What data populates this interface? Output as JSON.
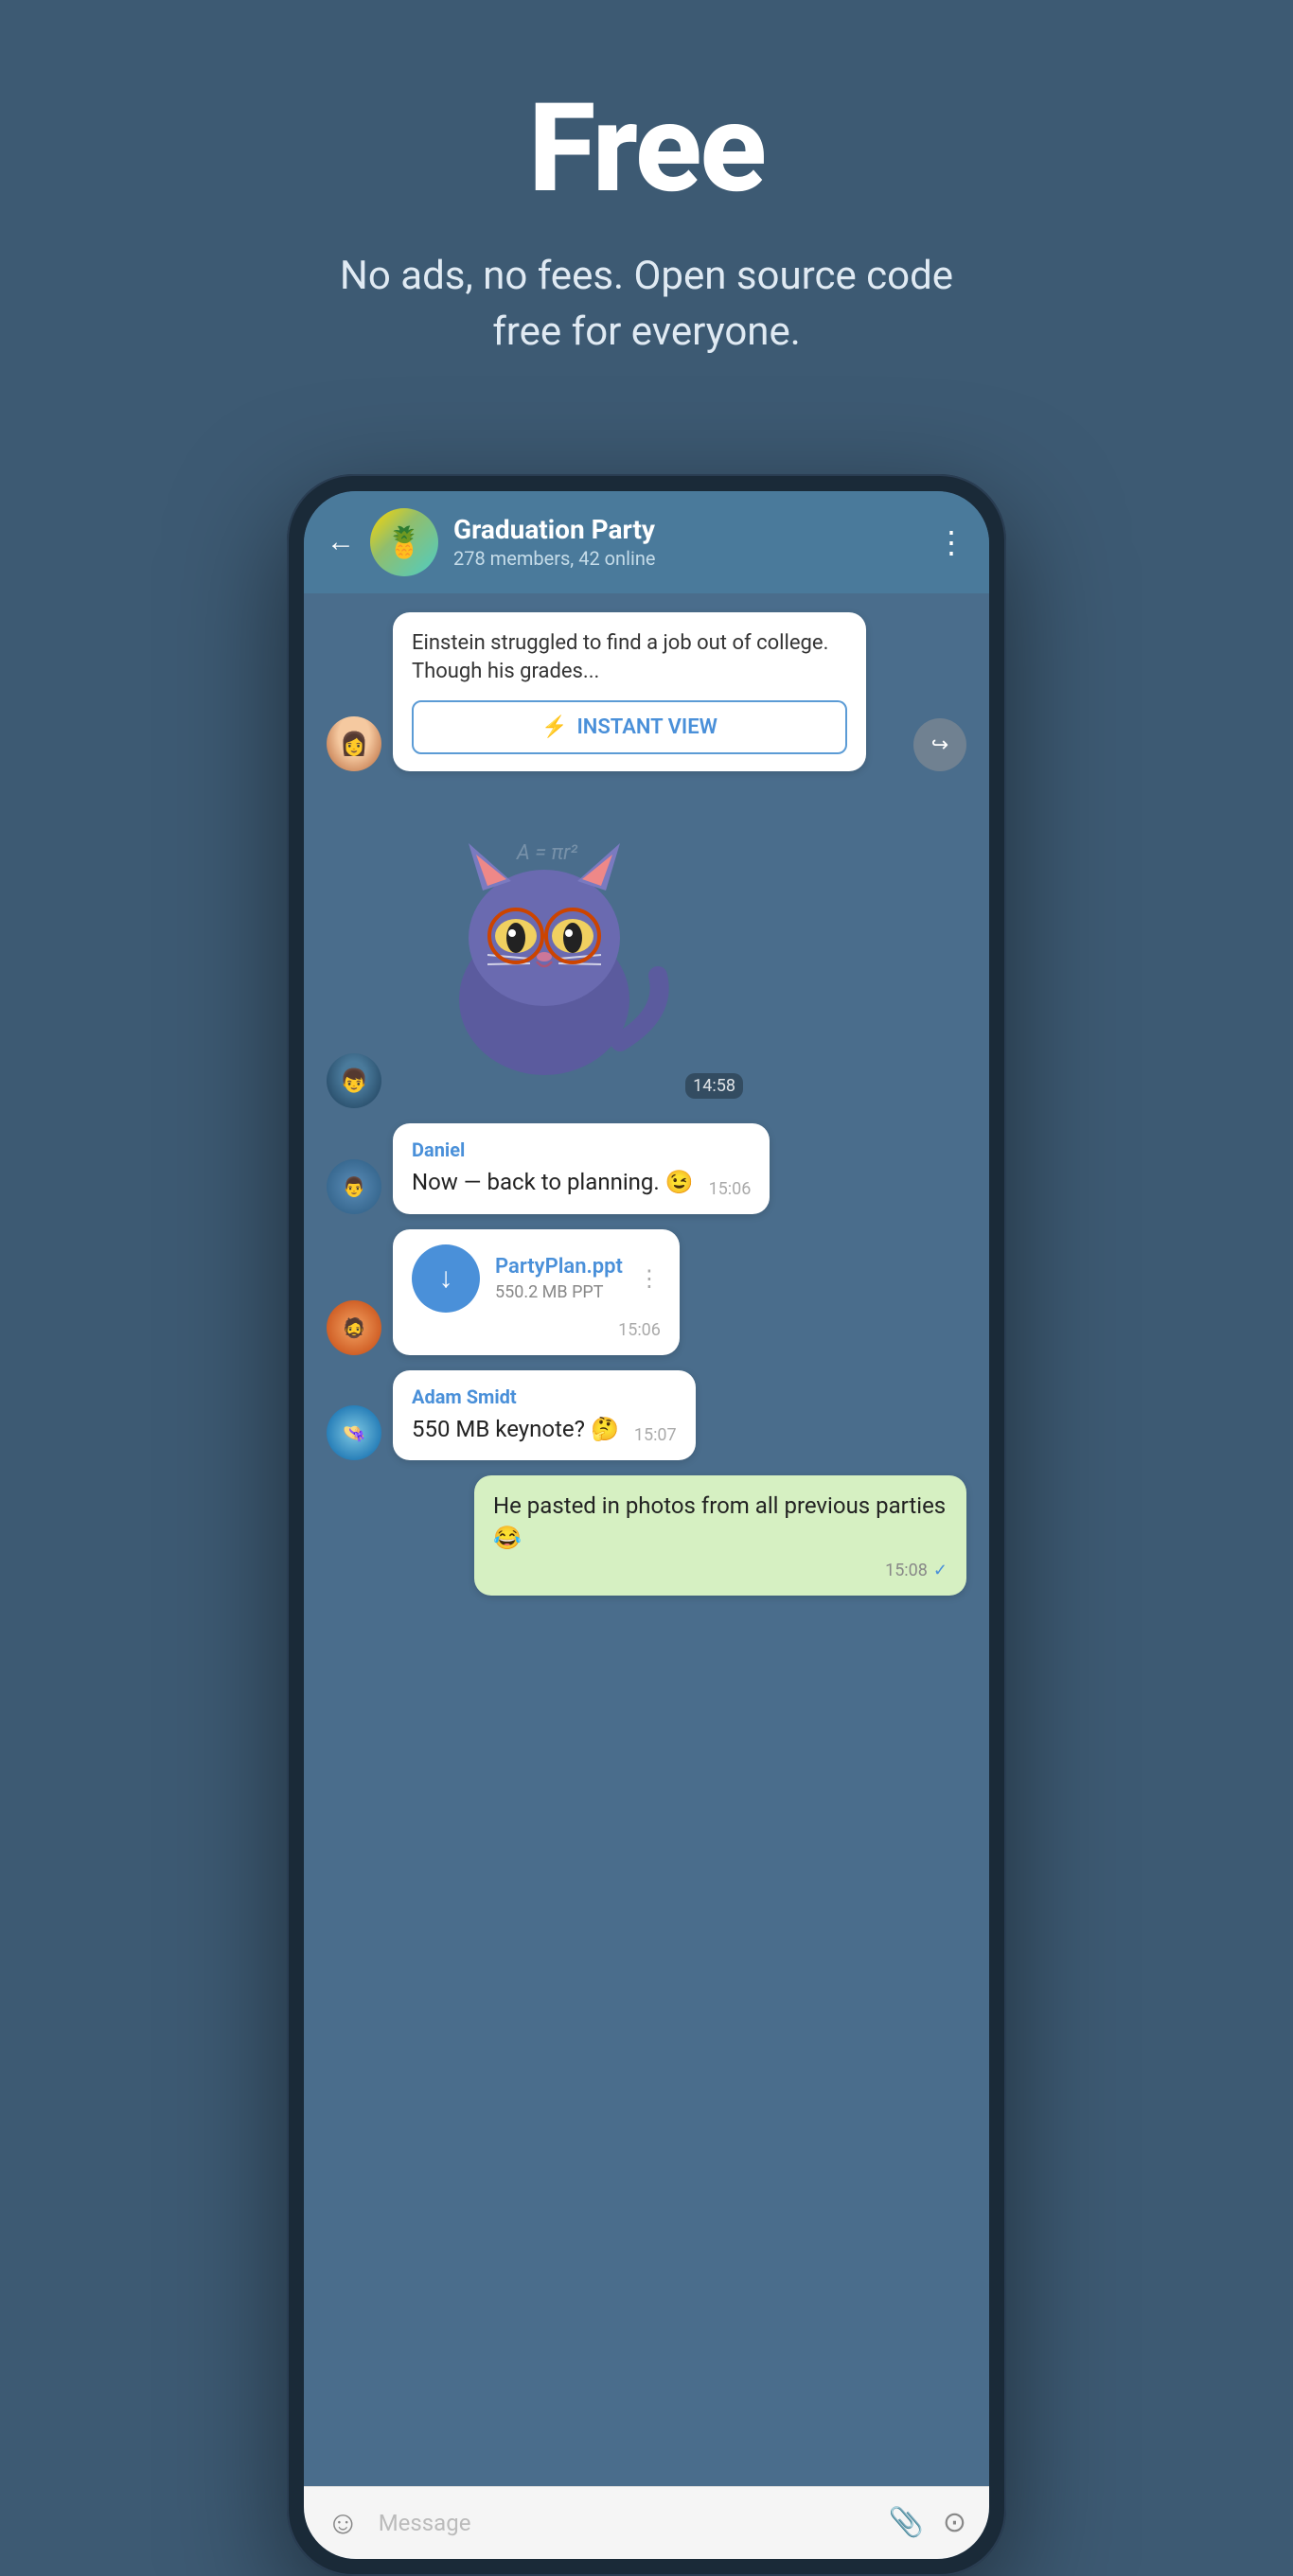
{
  "hero": {
    "title": "Free",
    "subtitle": "No ads, no fees. Open source code free for everyone."
  },
  "chat": {
    "header": {
      "group_name": "Graduation Party",
      "members": "278 members, 42 online",
      "back_label": "←",
      "menu_label": "⋮"
    },
    "messages": [
      {
        "type": "article",
        "text": "Einstein struggled to find a job out of college. Though his grades...",
        "instant_view_label": "INSTANT VIEW"
      },
      {
        "type": "sticker",
        "time": "14:58"
      },
      {
        "type": "received",
        "sender": "Daniel",
        "text": "Now — back to planning. 😉",
        "time": "15:06"
      },
      {
        "type": "file",
        "filename": "PartyPlan.ppt",
        "filesize": "550.2 MB PPT",
        "time": "15:06"
      },
      {
        "type": "received",
        "sender": "Adam Smidt",
        "text": "550 MB keynote? 🤔",
        "time": "15:07"
      },
      {
        "type": "self",
        "text": "He pasted in photos from all previous parties 😂",
        "time": "15:08",
        "checkmark": "✓"
      }
    ],
    "input": {
      "placeholder": "Message",
      "emoji_icon": "☺",
      "attach_icon": "📎",
      "camera_icon": "⊙"
    }
  }
}
